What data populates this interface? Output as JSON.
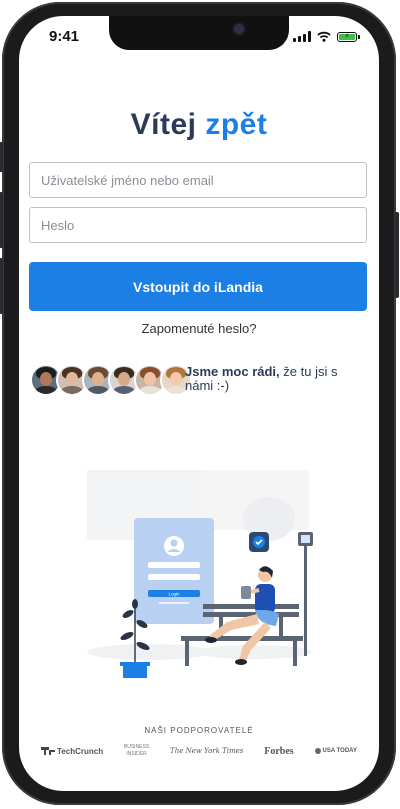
{
  "status_bar": {
    "time": "9:41"
  },
  "header": {
    "title_part1": "Vítej",
    "title_part2": "zpět"
  },
  "form": {
    "username_placeholder": "Uživatelské jméno nebo email",
    "password_placeholder": "Heslo",
    "submit_label": "Vstoupit do iLandia",
    "forgot_label": "Zapomenuté heslo?"
  },
  "social_proof": {
    "bold_text": "Jsme moc rádi,",
    "rest_text": " že tu jsi s námi :-)"
  },
  "illustration": {
    "mini_button_label": "Login"
  },
  "partners": {
    "title": "NAŠI PODPOROVATELÉ",
    "logos": [
      "TechCrunch",
      "BUSINESS",
      "INSIDER",
      "The New York Times",
      "Forbes",
      "USA TODAY"
    ]
  },
  "colors": {
    "accent": "#1c7fe6",
    "heading_dark": "#2a3b5a"
  }
}
